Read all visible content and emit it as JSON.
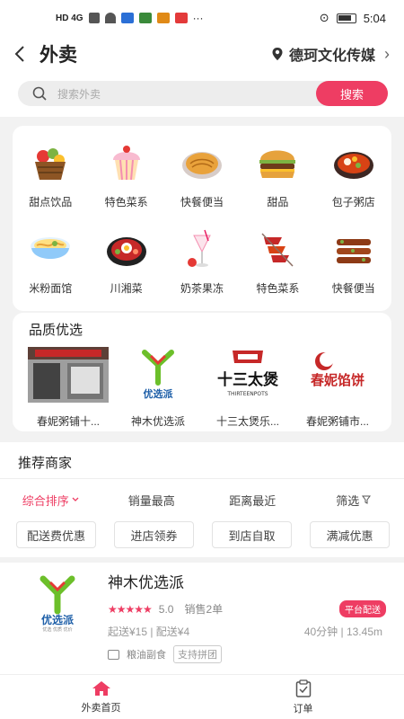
{
  "status_bar": {
    "network": "HD 4G",
    "time": "5:04"
  },
  "header": {
    "title": "外卖",
    "location": "德珂文化传媒"
  },
  "search": {
    "placeholder": "搜索外卖",
    "button": "搜索"
  },
  "categories": [
    {
      "label": "甜点饮品",
      "icon": "fruit-basket-icon"
    },
    {
      "label": "特色菜系",
      "icon": "cupcake-icon"
    },
    {
      "label": "快餐便当",
      "icon": "pancake-icon"
    },
    {
      "label": "甜品",
      "icon": "burger-icon"
    },
    {
      "label": "包子粥店",
      "icon": "hotpot-icon"
    },
    {
      "label": "米粉面馆",
      "icon": "noodle-bowl-icon"
    },
    {
      "label": "川湘菜",
      "icon": "stone-pot-icon"
    },
    {
      "label": "奶茶果冻",
      "icon": "milk-tea-icon"
    },
    {
      "label": "特色菜系",
      "icon": "skewer-icon"
    },
    {
      "label": "快餐便当",
      "icon": "bbq-icon"
    }
  ],
  "quality": {
    "title": "品质优选",
    "items": [
      {
        "label": "春妮粥铺十..."
      },
      {
        "label": "神木优选派",
        "logo_text": "优选派"
      },
      {
        "label": "十三太煲乐...",
        "logo_text": "十三太煲",
        "logo_sub": "THIRTEENPOTS"
      },
      {
        "label": "春妮粥铺市...",
        "logo_text": "春妮馅饼"
      }
    ]
  },
  "recommend": {
    "title": "推荐商家",
    "sorts": [
      "综合排序",
      "销量最高",
      "距离最近",
      "筛选"
    ],
    "filters": [
      "配送费优惠",
      "进店领券",
      "到店自取",
      "满减优惠"
    ]
  },
  "store": {
    "name": "神木优选派",
    "logo_text": "优选派",
    "logo_sub": "优选 优质 优价",
    "stars": "★★★★★",
    "score": "5.0",
    "sales": "销售2单",
    "badge": "平台配送",
    "fees": "起送¥15 | 配送¥4",
    "distance": "40分钟 | 13.45m",
    "category": "粮油副食",
    "tag": "支持拼团"
  },
  "bottom_nav": [
    {
      "label": "外卖首页",
      "icon": "home-icon"
    },
    {
      "label": "订单",
      "icon": "order-icon"
    }
  ],
  "colors": {
    "accent": "#ee3d63",
    "logo_green": "#6cbf2a"
  }
}
